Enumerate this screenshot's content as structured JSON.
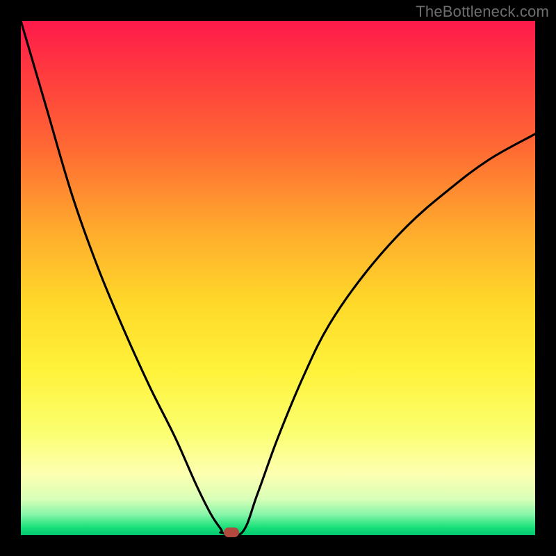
{
  "watermark": {
    "text": "TheBottleneck.com"
  },
  "colors": {
    "frame_bg": "#000000",
    "gradient_top": "#ff1a4b",
    "gradient_bottom": "#02c66f",
    "curve_stroke": "#000000",
    "marker_fill": "#b1493e",
    "watermark_text": "#6e6e6e"
  },
  "marker": {
    "x_fraction": 0.41,
    "y_fraction": 0.995
  },
  "chart_data": {
    "type": "line",
    "title": "",
    "xlabel": "",
    "ylabel": "",
    "xlim": [
      0,
      1
    ],
    "ylim": [
      0,
      1
    ],
    "series": [
      {
        "name": "left-branch",
        "x": [
          0.0,
          0.05,
          0.1,
          0.15,
          0.2,
          0.25,
          0.3,
          0.34,
          0.37,
          0.39
        ],
        "y": [
          1.0,
          0.83,
          0.66,
          0.52,
          0.4,
          0.29,
          0.19,
          0.1,
          0.04,
          0.01
        ]
      },
      {
        "name": "plateau",
        "x": [
          0.39,
          0.43
        ],
        "y": [
          0.005,
          0.005
        ]
      },
      {
        "name": "right-branch",
        "x": [
          0.43,
          0.46,
          0.5,
          0.55,
          0.6,
          0.67,
          0.75,
          0.83,
          0.91,
          1.0
        ],
        "y": [
          0.005,
          0.08,
          0.19,
          0.31,
          0.41,
          0.51,
          0.6,
          0.67,
          0.73,
          0.78
        ]
      }
    ],
    "marker": {
      "name": "highlight-point",
      "x": 0.41,
      "y": 0.005
    },
    "background_gradient": {
      "orientation": "vertical",
      "stops": [
        {
          "pos": 0.0,
          "color": "#ff1a4b"
        },
        {
          "pos": 0.25,
          "color": "#ff6a33"
        },
        {
          "pos": 0.55,
          "color": "#ffd92a"
        },
        {
          "pos": 0.8,
          "color": "#fbff70"
        },
        {
          "pos": 0.95,
          "color": "#86f5a8"
        },
        {
          "pos": 1.0,
          "color": "#02c66f"
        }
      ]
    }
  }
}
